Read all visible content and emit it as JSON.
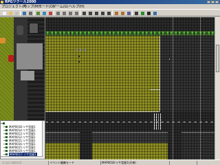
{
  "window": {
    "title": "RPGツクール2000"
  },
  "menubar": {
    "items": [
      "プロジェクト(F)",
      "マップ(M)",
      "モード(O)",
      "ゲーム(G)",
      "ヘルプ(H)"
    ]
  },
  "toolbar": {
    "buttons": [
      {
        "icon": "new-project-icon",
        "color": "#f4f4f4"
      },
      {
        "icon": "open-project-icon",
        "color": "#e8c060"
      },
      {
        "icon": "close-project-icon",
        "color": "#c0c0c0"
      },
      {
        "icon": "save-icon",
        "color": "#3a6ea5"
      },
      {
        "icon": "undo-icon",
        "color": "#6a6a6a"
      },
      {
        "icon": "lower-layer-icon",
        "color": "#5a8a3a"
      },
      {
        "icon": "upper-layer-icon",
        "color": "#3a8ac0"
      },
      {
        "icon": "event-layer-icon",
        "color": "#c04040"
      },
      {
        "icon": "zoom-1-1-icon",
        "color": "#707070"
      },
      {
        "icon": "zoom-1-2-icon",
        "color": "#707070"
      },
      {
        "icon": "zoom-1-4-icon",
        "color": "#707070"
      },
      {
        "icon": "zoom-1-8-icon",
        "color": "#707070"
      },
      {
        "icon": "pencil-icon",
        "color": "#404040"
      },
      {
        "icon": "rectangle-icon",
        "color": "#404040"
      },
      {
        "icon": "ellipse-icon",
        "color": "#404040"
      },
      {
        "icon": "fill-icon",
        "color": "#404040"
      },
      {
        "icon": "select-icon",
        "color": "#404040"
      },
      {
        "icon": "database-icon",
        "color": "#b07030"
      },
      {
        "icon": "material-icon",
        "color": "#b07030"
      },
      {
        "icon": "script-icon",
        "color": "#5a5a9a"
      },
      {
        "icon": "music-icon",
        "color": "#3a3a3a"
      },
      {
        "icon": "test-play-icon",
        "color": "#2a8a2a"
      },
      {
        "icon": "fullscreen-icon",
        "color": "#2a2a2a"
      },
      {
        "icon": "help-icon",
        "color": "#3a6ea5"
      }
    ]
  },
  "map_tree": {
    "items": [
      {
        "label": "",
        "indent": 0,
        "folder": true
      },
      {
        "label": "MAP0018:リサ型屋1",
        "indent": 1
      },
      {
        "label": "MAP0014:リサ型屋1",
        "indent": 1
      },
      {
        "label": "MAP0013:リサ型屋1",
        "indent": 1
      },
      {
        "label": "MAP0012:リサ型屋1",
        "indent": 1
      },
      {
        "label": "MAP0011:リサ型屋1",
        "indent": 1
      },
      {
        "label": "MAP0016:リサ型屋1",
        "indent": 1
      },
      {
        "label": "MAP0015:リサ型屋1",
        "indent": 1
      },
      {
        "label": "MAP0019:リサ型屋1",
        "indent": 1
      },
      {
        "label": "MAP0017:リサ型屋1",
        "indent": 1,
        "selected": true
      },
      {
        "label": "MAP0020:リサ型屋1",
        "indent": 1
      }
    ]
  },
  "left_status": "ニコニコのロゴ",
  "statusbar": {
    "mode": "イベント編集モード",
    "map": "MAP0018:リサ型屋1(天神)",
    "coord": "",
    "extra": ""
  },
  "colors": {
    "grass": "#8f8f24",
    "asphalt": "#333333",
    "road": "#2a2a2a",
    "fence_light": "#5ec040",
    "title_bar": "#0a246a"
  }
}
